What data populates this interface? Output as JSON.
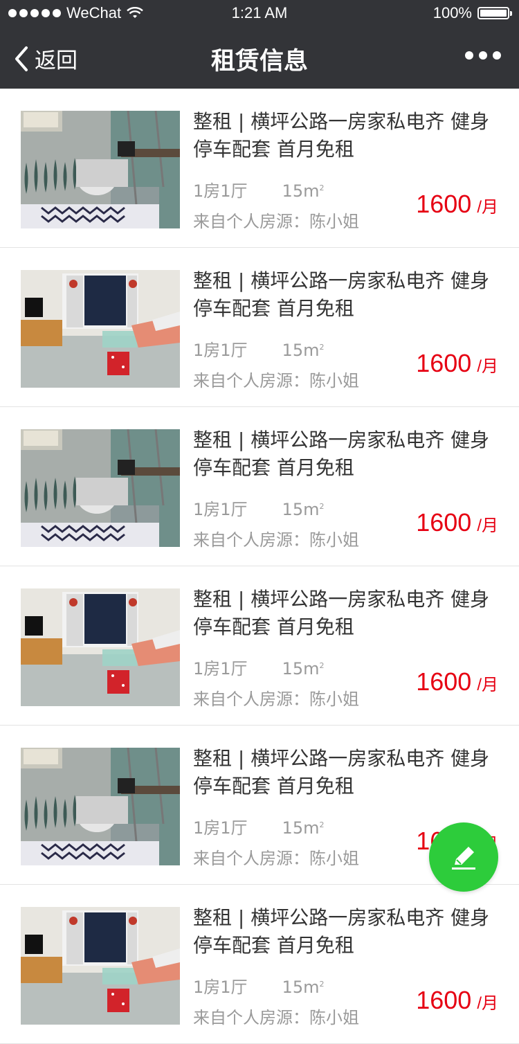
{
  "status_bar": {
    "carrier": "WeChat",
    "time": "1:21 AM",
    "battery": "100%"
  },
  "nav": {
    "back_label": "返回",
    "title": "租赁信息",
    "more_icon": "more-dots-icon"
  },
  "listings": [
    {
      "title": "整租 | 横坪公路一房家私电齐 健身停车配套 首月免租",
      "layout": "1房1厅",
      "area": "15m",
      "area_unit_sup": "2",
      "source": "来自个人房源：陈小姐",
      "price": "1600",
      "unit": "/月",
      "photo": "bedroom"
    },
    {
      "title": "整租 | 横坪公路一房家私电齐 健身停车配套 首月免租",
      "layout": "1房1厅",
      "area": "15m",
      "area_unit_sup": "2",
      "source": "来自个人房源：陈小姐",
      "price": "1600",
      "unit": "/月",
      "photo": "living"
    },
    {
      "title": "整租 | 横坪公路一房家私电齐 健身停车配套 首月免租",
      "layout": "1房1厅",
      "area": "15m",
      "area_unit_sup": "2",
      "source": "来自个人房源：陈小姐",
      "price": "1600",
      "unit": "/月",
      "photo": "bedroom"
    },
    {
      "title": "整租 | 横坪公路一房家私电齐 健身停车配套 首月免租",
      "layout": "1房1厅",
      "area": "15m",
      "area_unit_sup": "2",
      "source": "来自个人房源：陈小姐",
      "price": "1600",
      "unit": "/月",
      "photo": "living"
    },
    {
      "title": "整租 | 横坪公路一房家私电齐 健身停车配套 首月免租",
      "layout": "1房1厅",
      "area": "15m",
      "area_unit_sup": "2",
      "source": "来自个人房源：陈小姐",
      "price": "1600",
      "unit": "/月",
      "photo": "bedroom"
    },
    {
      "title": "整租 | 横坪公路一房家私电齐 健身停车配套 首月免租",
      "layout": "1房1厅",
      "area": "15m",
      "area_unit_sup": "2",
      "source": "来自个人房源：陈小姐",
      "price": "1600",
      "unit": "/月",
      "photo": "living"
    }
  ],
  "fab": {
    "icon": "pencil-icon",
    "color": "#2dcc3b"
  },
  "colors": {
    "nav_bg": "#333438",
    "price": "#e60012",
    "secondary_text": "#9a9a9a"
  }
}
